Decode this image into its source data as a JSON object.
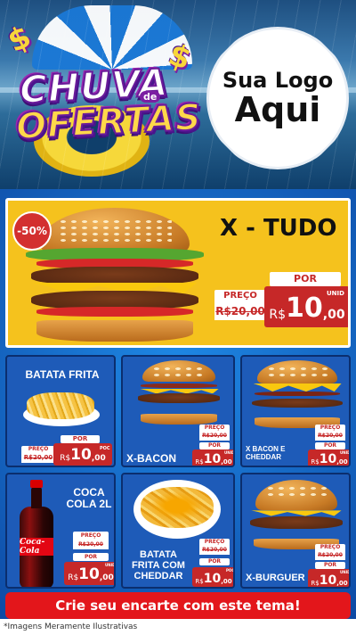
{
  "header": {
    "title_line1": "CHUVA",
    "title_de": "de",
    "title_line2": "OFERTAS",
    "logo_line1": "Sua Logo",
    "logo_line2": "Aqui"
  },
  "hero": {
    "name": "X - TUDO",
    "discount": "-50%",
    "preco_label": "PREÇO",
    "old_price": "R$20,00",
    "por_label": "POR",
    "currency": "R$",
    "price_int": "10",
    "price_dec": ",00",
    "unit": "UNID"
  },
  "products": [
    {
      "name": "BATATA FRITA",
      "preco_label": "PREÇO",
      "old_price": "R$20,00",
      "por_label": "POR",
      "currency": "R$",
      "price_int": "10",
      "price_dec": ",00",
      "unit": "POC"
    },
    {
      "name": "X-BACON",
      "preco_label": "PREÇO",
      "old_price": "R$20,00",
      "por_label": "POR",
      "currency": "R$",
      "price_int": "10",
      "price_dec": ",00",
      "unit": "UNID"
    },
    {
      "name": "X BACON E CHEDDAR",
      "preco_label": "PREÇO",
      "old_price": "R$20,00",
      "por_label": "POR",
      "currency": "R$",
      "price_int": "10",
      "price_dec": ",00",
      "unit": "UNID"
    },
    {
      "name": "COCA COLA 2L",
      "preco_label": "PREÇO",
      "old_price": "R$20,00",
      "por_label": "POR",
      "currency": "R$",
      "price_int": "10",
      "price_dec": ",00",
      "unit": "UNID"
    },
    {
      "name": "BATATA FRITA COM CHEDDAR",
      "preco_label": "PREÇO",
      "old_price": "R$20,00",
      "por_label": "POR",
      "currency": "R$",
      "price_int": "10",
      "price_dec": ",00",
      "unit": "POC"
    },
    {
      "name": "X-BURGUER",
      "preco_label": "PREÇO",
      "old_price": "R$20,00",
      "por_label": "POR",
      "currency": "R$",
      "price_int": "10",
      "price_dec": ",00",
      "unit": "UNID"
    }
  ],
  "bottle_brand": "Coca-Cola",
  "cta": "Crie seu encarte com este tema!",
  "footnote": "*Imagens Meramente Ilustrativas",
  "colors": {
    "red": "#c62828",
    "yellow": "#f5c21d",
    "blue": "#1565c0"
  },
  "icons": {
    "dollar": "dollar-sign-icon"
  }
}
